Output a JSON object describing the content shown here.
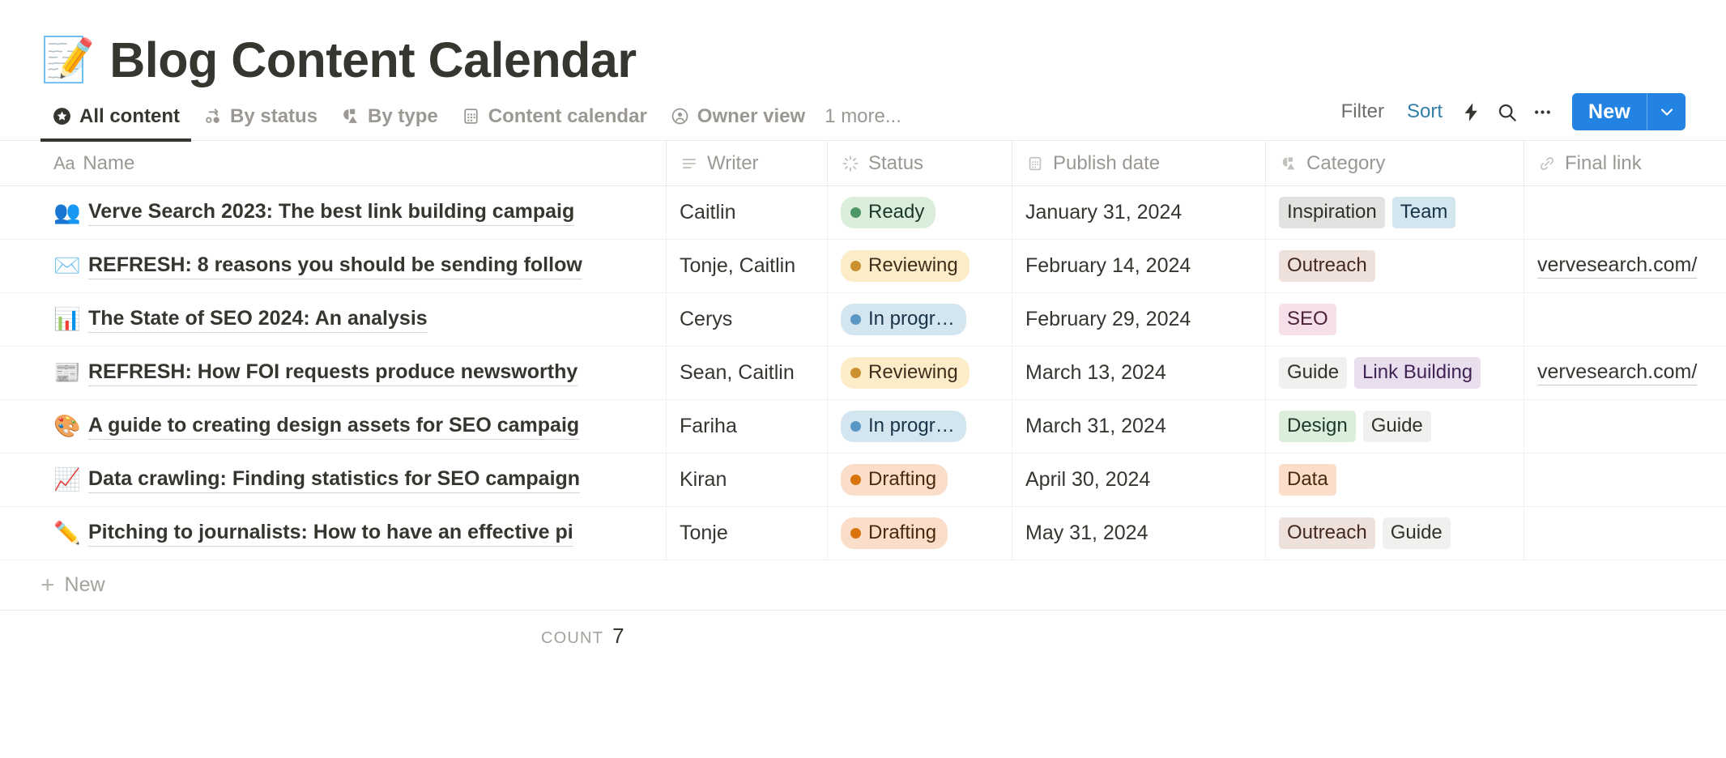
{
  "page": {
    "icon": "memo-emoji",
    "icon_glyph": "📝",
    "title": "Blog Content Calendar"
  },
  "views": {
    "tabs": [
      {
        "label": "All content",
        "icon": "star-circle-icon",
        "active": true
      },
      {
        "label": "By status",
        "icon": "status-nodes-icon",
        "active": false
      },
      {
        "label": "By type",
        "icon": "shapes-icon",
        "active": false
      },
      {
        "label": "Content calendar",
        "icon": "calendar-icon",
        "active": false
      },
      {
        "label": "Owner view",
        "icon": "person-circle-icon",
        "active": false
      }
    ],
    "more_label": "1 more..."
  },
  "toolbar": {
    "filter_label": "Filter",
    "sort_label": "Sort",
    "sort_active_color": "#337ea9",
    "automation_icon": "lightning-bolt-icon",
    "search_icon": "search-icon",
    "more_icon": "ellipsis-icon",
    "new_label": "New",
    "new_chevron_icon": "chevron-down-icon",
    "new_button_color": "#2383e2"
  },
  "table": {
    "columns": [
      {
        "label": "Name",
        "icon": "title-aa-icon",
        "type": "title"
      },
      {
        "label": "Writer",
        "icon": "text-lines-icon",
        "type": "text"
      },
      {
        "label": "Status",
        "icon": "status-spinner-icon",
        "type": "status"
      },
      {
        "label": "Publish date",
        "icon": "calendar-icon",
        "type": "date"
      },
      {
        "label": "Category",
        "icon": "multi-select-shapes-icon",
        "type": "multi_select"
      },
      {
        "label": "Final link",
        "icon": "link-chain-icon",
        "type": "url"
      }
    ],
    "rows": [
      {
        "emoji": "👥",
        "emoji_name": "people-emoji",
        "name": "Verve Search 2023: The best link building campaig",
        "writer": "Caitlin",
        "status": {
          "label": "Ready",
          "bg": "#dbeddb",
          "fg": "#1c3829",
          "dot": "#4f9768"
        },
        "date": "January 31, 2024",
        "categories": [
          {
            "label": "Inspiration",
            "bg": "#e3e2e0",
            "fg": "#32302c"
          },
          {
            "label": "Team",
            "bg": "#d3e5ef",
            "fg": "#183347"
          }
        ],
        "link": ""
      },
      {
        "emoji": "✉️",
        "emoji_name": "envelope-emoji",
        "name": "REFRESH: 8 reasons you should be sending follow",
        "writer": "Tonje, Caitlin",
        "status": {
          "label": "Reviewing",
          "bg": "#fdecc8",
          "fg": "#402c1b",
          "dot": "#cb912f"
        },
        "date": "February 14, 2024",
        "categories": [
          {
            "label": "Outreach",
            "bg": "#eee0da",
            "fg": "#442a1e"
          }
        ],
        "link": "vervesearch.com/"
      },
      {
        "emoji": "📊",
        "emoji_name": "pie-chart-emoji",
        "name": "The State of SEO 2024: An analysis",
        "writer": "Cerys",
        "status": {
          "label": "In progr…",
          "bg": "#d3e5ef",
          "fg": "#183347",
          "dot": "#5b97c4"
        },
        "date": "February 29, 2024",
        "categories": [
          {
            "label": "SEO",
            "bg": "#f5e0e9",
            "fg": "#4c2238"
          }
        ],
        "link": ""
      },
      {
        "emoji": "📰",
        "emoji_name": "newspaper-emoji",
        "name": "REFRESH: How FOI requests produce newsworthy",
        "writer": "Sean, Caitlin",
        "status": {
          "label": "Reviewing",
          "bg": "#fdecc8",
          "fg": "#402c1b",
          "dot": "#cb912f"
        },
        "date": "March 13, 2024",
        "categories": [
          {
            "label": "Guide",
            "bg": "#f1f0ef",
            "fg": "#32302c"
          },
          {
            "label": "Link Building",
            "bg": "#e8deee",
            "fg": "#412454"
          }
        ],
        "link": "vervesearch.com/"
      },
      {
        "emoji": "🎨",
        "emoji_name": "palette-emoji",
        "name": "A guide to creating design assets for SEO campaig",
        "writer": "Fariha",
        "status": {
          "label": "In progr…",
          "bg": "#d3e5ef",
          "fg": "#183347",
          "dot": "#5b97c4"
        },
        "date": "March 31, 2024",
        "categories": [
          {
            "label": "Design",
            "bg": "#dbeddb",
            "fg": "#1c3829"
          },
          {
            "label": "Guide",
            "bg": "#f1f0ef",
            "fg": "#32302c"
          }
        ],
        "link": ""
      },
      {
        "emoji": "📈",
        "emoji_name": "chart-increasing-emoji",
        "name": "Data crawling: Finding statistics for SEO campaign",
        "writer": "Kiran",
        "status": {
          "label": "Drafting",
          "bg": "#fadec9",
          "fg": "#49290e",
          "dot": "#d9730d"
        },
        "date": "April 30, 2024",
        "categories": [
          {
            "label": "Data",
            "bg": "#fadec9",
            "fg": "#49290e"
          }
        ],
        "link": ""
      },
      {
        "emoji": "✏️",
        "emoji_name": "pencil-emoji",
        "name": "Pitching to journalists: How to have an effective pi",
        "writer": "Tonje",
        "status": {
          "label": "Drafting",
          "bg": "#fadec9",
          "fg": "#49290e",
          "dot": "#d9730d"
        },
        "date": "May 31, 2024",
        "categories": [
          {
            "label": "Outreach",
            "bg": "#eee0da",
            "fg": "#442a1e"
          },
          {
            "label": "Guide",
            "bg": "#f1f0ef",
            "fg": "#32302c"
          }
        ],
        "link": ""
      }
    ],
    "new_row_label": "New",
    "count_label": "COUNT",
    "count_value": "7"
  }
}
